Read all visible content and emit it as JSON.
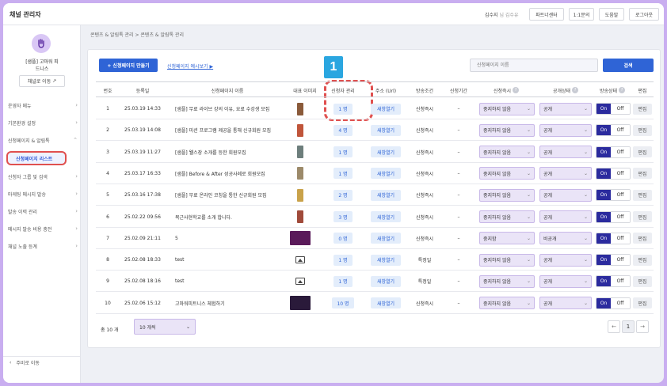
{
  "header": {
    "app_title": "채널 관리자",
    "user_name": "김수지",
    "user_role": "님 김수유",
    "buttons": [
      "파트너센터",
      "1:1문의",
      "도움말",
      "로그아웃"
    ]
  },
  "sidebar": {
    "channel_name": "[샘플] 고마워 피드니스",
    "channel_button": "채널로 이동",
    "items": [
      {
        "label": "운영자 메뉴",
        "chev": "›"
      },
      {
        "label": "기본환경 설정",
        "chev": "›"
      },
      {
        "label": "신청페이지 & 알림톡",
        "chev": "⌃"
      },
      {
        "label": "신청자 그룹 및 검색",
        "chev": "›"
      },
      {
        "label": "마케팅 메시지 발송",
        "chev": "›"
      },
      {
        "label": "발송 이력 관리",
        "chev": "›"
      },
      {
        "label": "메시지 발송 비용 충전",
        "chev": "›"
      },
      {
        "label": "채널 노출 등계",
        "chev": "›"
      }
    ],
    "active_sub": "신청페이지 리스트",
    "bottom": "주비로 이동"
  },
  "breadcrumb": "콘텐츠 & 알림톡 관리 > 콘텐츠 & 알림톡 관리",
  "toolbar": {
    "create_label": "+ 신청페이지 만들기",
    "example_link": "신청페이지 예시보기 ▶",
    "search_placeholder": "신청페이지 이름",
    "search_label": "검색"
  },
  "annotation": {
    "number": "1"
  },
  "table": {
    "columns": [
      "번호",
      "등록일",
      "신청페이지 이름",
      "대표 이미지",
      "신청자 관리",
      "주소 (Url)",
      "방송조건",
      "신청기간",
      "신청즉시",
      "공개상태",
      "방송상태",
      "편집"
    ],
    "rows": [
      {
        "no": "1",
        "date": "25.03.19 14:33",
        "name": "[샘플] 무료 라이브 강의 이유, 요료 수강생 모집",
        "img": "thumb",
        "thumb_color": "#8a5a3a",
        "applicants": "1 명",
        "url": "새창열기",
        "cond": "신청즉시",
        "period": "–",
        "apply": "중지하지 않음",
        "visibility": "공개",
        "on": "On",
        "off": "Off",
        "edit": "편집"
      },
      {
        "no": "2",
        "date": "25.03.19 14:08",
        "name": "[샘플] 미션 프로그램 제공을 통해 신규회원 모집",
        "img": "thumb",
        "thumb_color": "#c0553a",
        "applicants": "4 명",
        "url": "새창열기",
        "cond": "신청즉시",
        "period": "–",
        "apply": "중지하지 않음",
        "visibility": "공개",
        "on": "On",
        "off": "Off",
        "edit": "편집"
      },
      {
        "no": "3",
        "date": "25.03.19 11:27",
        "name": "[샘플] 웰스장 소개를 등한 회원모집",
        "img": "thumb",
        "thumb_color": "#6d7e7c",
        "applicants": "1 명",
        "url": "새창열기",
        "cond": "신청즉시",
        "period": "–",
        "apply": "중지하지 않음",
        "visibility": "공개",
        "on": "On",
        "off": "Off",
        "edit": "편집"
      },
      {
        "no": "4",
        "date": "25.03.17 16:33",
        "name": "[샘플] Before & After 성공사례로 회원모집",
        "img": "thumb",
        "thumb_color": "#9c8a6a",
        "applicants": "1 명",
        "url": "새창열기",
        "cond": "신청즉시",
        "period": "–",
        "apply": "중지하지 않음",
        "visibility": "공개",
        "on": "On",
        "off": "Off",
        "edit": "편집"
      },
      {
        "no": "5",
        "date": "25.03.16 17:38",
        "name": "[샘플] 무료 온라인 코칭을 통한 신규회원 모집",
        "img": "thumb",
        "thumb_color": "#c9a24a",
        "applicants": "2 명",
        "url": "새창열기",
        "cond": "신청즉시",
        "period": "–",
        "apply": "중지하지 않음",
        "visibility": "공개",
        "on": "On",
        "off": "Off",
        "edit": "편집"
      },
      {
        "no": "6",
        "date": "25.02.22 09:56",
        "name": "북근사현학교를 소개 합니다.",
        "img": "thumb",
        "thumb_color": "#a04a3a",
        "applicants": "3 명",
        "url": "새창열기",
        "cond": "신청즉시",
        "period": "–",
        "apply": "중지하지 않음",
        "visibility": "공개",
        "on": "On",
        "off": "Off",
        "edit": "편집"
      },
      {
        "no": "7",
        "date": "25.02.09 21:11",
        "name": "5",
        "img": "wide",
        "thumb_color": "#5a1a5a",
        "applicants": "0 명",
        "url": "새창열기",
        "cond": "신청즉시",
        "period": "–",
        "apply": "중지함",
        "visibility": "비공개",
        "on": "On",
        "off": "Off",
        "edit": "편집"
      },
      {
        "no": "8",
        "date": "25.02.08 18:33",
        "name": "test",
        "img": "icon",
        "thumb_color": "",
        "applicants": "1 명",
        "url": "새창열기",
        "cond": "특정일",
        "period": "–",
        "apply": "중지하지 않음",
        "visibility": "공개",
        "on": "On",
        "off": "Off",
        "edit": "편집"
      },
      {
        "no": "9",
        "date": "25.02.08 18:16",
        "name": "test",
        "img": "icon",
        "thumb_color": "",
        "applicants": "1 명",
        "url": "새창열기",
        "cond": "특정일",
        "period": "–",
        "apply": "중지하지 않음",
        "visibility": "공개",
        "on": "On",
        "off": "Off",
        "edit": "편집"
      },
      {
        "no": "10",
        "date": "25.02.06 15:12",
        "name": "고마워피트니스 체험하기",
        "img": "wide",
        "thumb_color": "#2a1a3a",
        "applicants": "10 명",
        "url": "새창열기",
        "cond": "신청즉시",
        "period": "–",
        "apply": "중지하지 않음",
        "visibility": "공개",
        "on": "On",
        "off": "Off",
        "edit": "편집"
      }
    ]
  },
  "footer": {
    "total": "총 10 개",
    "per_page": "10 개씩",
    "current_page": "1",
    "prev": "←",
    "next": "→"
  }
}
